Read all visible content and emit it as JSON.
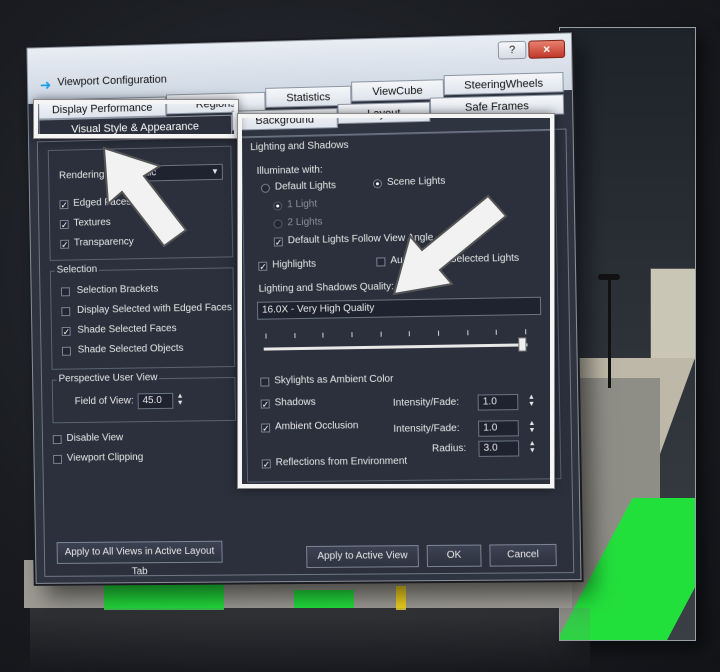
{
  "window": {
    "title": "Viewport Configuration",
    "help": "?",
    "close": "×"
  },
  "tabs": {
    "row1": [
      "Display Performance",
      "Regions",
      "Statistics",
      "ViewCube",
      "SteeringWheels"
    ],
    "row2": [
      "Visual Style & Appearance",
      "Background",
      "Layout",
      "Safe Frames"
    ]
  },
  "left": {
    "rendering_label": "Rendering",
    "rendering_value": "Realistic",
    "checks": [
      {
        "label": "Edged Faces",
        "checked": true
      },
      {
        "label": "Textures",
        "checked": true
      },
      {
        "label": "Transparency",
        "checked": true
      }
    ],
    "selection": {
      "title": "Selection",
      "items": [
        {
          "label": "Selection Brackets",
          "checked": false
        },
        {
          "label": "Display Selected with Edged Faces",
          "checked": false
        },
        {
          "label": "Shade Selected Faces",
          "checked": true
        },
        {
          "label": "Shade Selected Objects",
          "checked": false
        }
      ]
    },
    "perspective": {
      "title": "Perspective User View",
      "fov_label": "Field of View:",
      "fov_value": "45.0"
    },
    "disable_view": "Disable View",
    "viewport_clipping": "Viewport Clipping",
    "apply_all": "Apply to All Views in Active Layout Tab"
  },
  "lighting": {
    "title": "Lighting and Shadows",
    "illuminate_label": "Illuminate with:",
    "default_lights": "Default Lights",
    "scene_lights": "Scene Lights",
    "one_light": "1 Light",
    "two_lights": "2 Lights",
    "follow_angle": "Default Lights Follow View Angle",
    "highlights": "Highlights",
    "auto_display": "Auto Display Selected Lights",
    "quality_label": "Lighting and Shadows Quality:",
    "quality_value": "16.0X - Very High Quality",
    "slider_fraction": 0.98,
    "skylights": "Skylights as Ambient Color",
    "shadows": "Shadows",
    "shadows_intensity_label": "Intensity/Fade:",
    "shadows_intensity": "1.0",
    "ambient_occlusion": "Ambient Occlusion",
    "ao_intensity_label": "Intensity/Fade:",
    "ao_intensity": "1.0",
    "radius_label": "Radius:",
    "radius_value": "3.0",
    "reflections": "Reflections from Environment"
  },
  "buttons": {
    "apply_active": "Apply to Active View",
    "ok": "OK",
    "cancel": "Cancel"
  }
}
